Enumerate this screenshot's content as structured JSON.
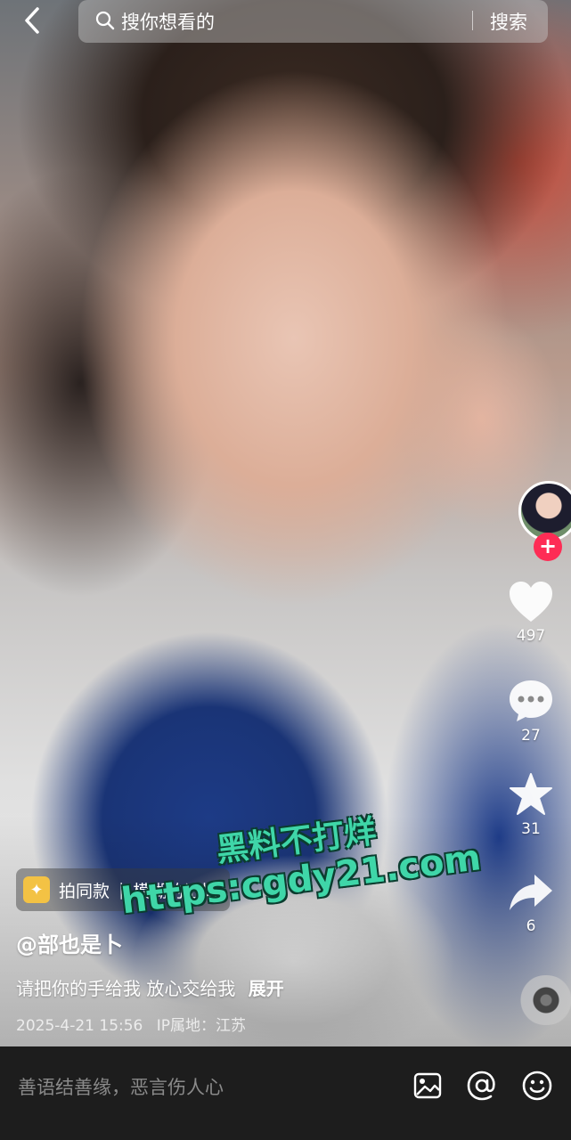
{
  "search": {
    "placeholder": "搜你想看的",
    "button_label": "搜索"
  },
  "actions": {
    "likes": "497",
    "comments": "27",
    "favorites": "31",
    "shares": "6"
  },
  "video": {
    "tag_label": "拍同款",
    "tag_music": "模糊的记忆",
    "author": "@部也是卜",
    "description": "请把你的手给我 放心交给我",
    "expand_label": "展开",
    "date": "2025-4-21 15:56",
    "ip_location": "IP属地：江苏"
  },
  "watermark": {
    "line1": "黑料不打烊",
    "line2": "https:cgdy21.com"
  },
  "comment_bar": {
    "placeholder": "善语结善缘，恶言伤人心"
  },
  "icons": [
    "back-icon",
    "search-icon",
    "heart-icon",
    "comment-icon",
    "star-icon",
    "share-icon",
    "image-icon",
    "at-icon",
    "emoji-icon"
  ]
}
